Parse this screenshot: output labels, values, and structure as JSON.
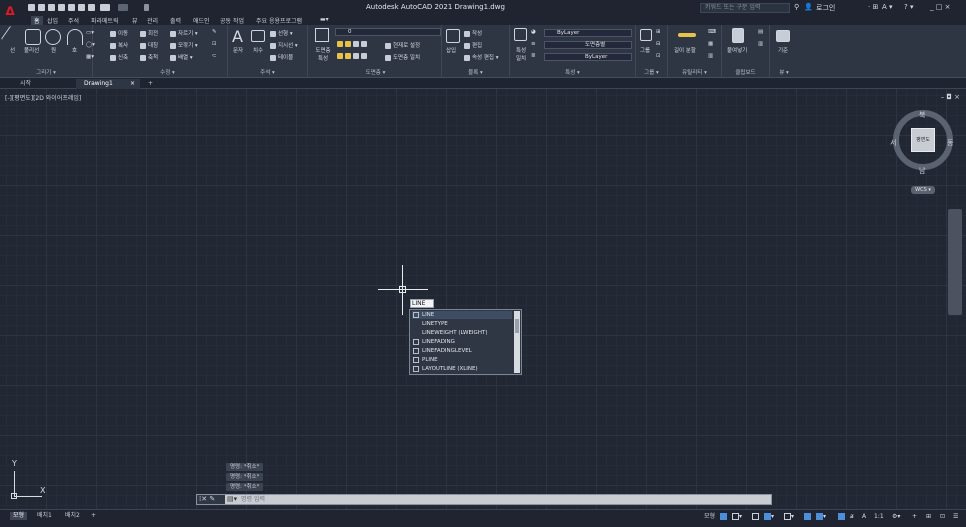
{
  "titlebar": {
    "app_logo": "A",
    "title": "Autodesk AutoCAD 2021    Drawing1.dwg",
    "search_placeholder": "키워드 또는 구문 입력",
    "login": "로그인",
    "window_controls": "_ □ ×"
  },
  "ribbon_tabs": [
    "홈",
    "삽입",
    "주석",
    "파라메트릭",
    "뷰",
    "관리",
    "출력",
    "애드인",
    "공동 작업",
    "주요 응용프로그램"
  ],
  "ribbon": {
    "draw": {
      "title": "그리기 ▾",
      "line": "선",
      "polyline": "폴리선",
      "circle": "원",
      "arc": "호"
    },
    "modify": {
      "title": "수정 ▾",
      "move": "이동",
      "rotate": "회전",
      "trim": "자르기",
      "copy": "복사",
      "mirror": "대칭",
      "fillet": "모깎기",
      "stretch": "신축",
      "scale": "축척",
      "array": "배열"
    },
    "annotation": {
      "title": "주석 ▾",
      "text": "문자",
      "dimension": "치수",
      "linear": "선형",
      "leader": "지시선",
      "table": "테이블"
    },
    "layers": {
      "title": "도면층 ▾",
      "layer_properties": "도면층 특성",
      "layer_value": "0",
      "make_current": "현재로 설정",
      "match_layer": "도면층 일치"
    },
    "block": {
      "title": "블록 ▾",
      "insert": "삽입",
      "create": "작성",
      "edit": "편집",
      "edit_attributes": "속성 편집"
    },
    "properties": {
      "title": "특성 ▾",
      "match": "특성 일치",
      "color": "ByLayer",
      "linetype": "도면층별",
      "lineweight": "ByLayer"
    },
    "groups": {
      "title": "그룹 ▾",
      "group": "그룹"
    },
    "utilities": {
      "title": "유틸리티 ▾",
      "measure": "길이 분할"
    },
    "clipboard": {
      "title": "클립보드",
      "paste": "붙여넣기"
    },
    "view": {
      "title": "뷰 ▾",
      "base": "기준"
    }
  },
  "doc_tabs": {
    "start": "시작",
    "drawing": "Drawing1",
    "close": "×",
    "new": "+"
  },
  "viewport": {
    "label": "[-][평면도][2D 와이어프레임]",
    "controls": "– ◘ ×"
  },
  "viewcube": {
    "north": "북",
    "south": "남",
    "east": "동",
    "west": "서",
    "face": "평면도",
    "wcs": "WCS ▾"
  },
  "command": {
    "typed": "LINE",
    "suggestions": [
      "LINE",
      "LINETYPE",
      "LINEWEIGHT (LWEIGHT)",
      "LINEFADING",
      "LINEFADINGLEVEL",
      "PLINE",
      "LAYOUTLINE (XLINE)"
    ],
    "history": [
      "명령: *취소*",
      "명령: *취소*",
      "명령: *취소*"
    ],
    "prompt_placeholder": "명령 입력"
  },
  "ucs": {
    "x": "X",
    "y": "Y"
  },
  "layout_tabs": [
    "모형",
    "배치1",
    "배치2",
    "+"
  ],
  "status": {
    "model": "모형",
    "scale": "1:1"
  }
}
